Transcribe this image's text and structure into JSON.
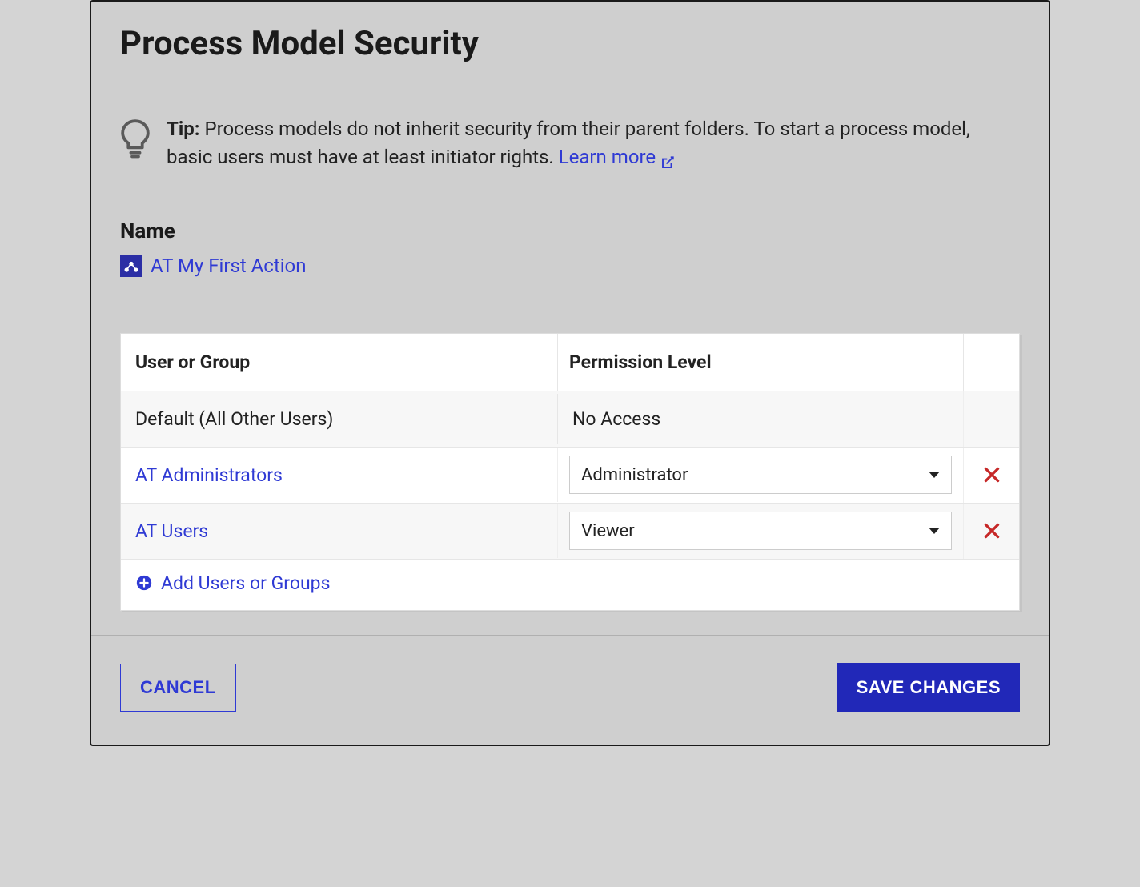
{
  "dialog": {
    "title": "Process Model Security"
  },
  "tip": {
    "label": "Tip:",
    "text": "Process models do not inherit security from their parent folders. To start a process model, basic users must have at least initiator rights.",
    "learn_more": "Learn more"
  },
  "name_section": {
    "label": "Name",
    "model_name": "AT My First Action"
  },
  "table": {
    "col_user": "User or Group",
    "col_perm": "Permission Level",
    "default_row": {
      "user": "Default (All Other Users)",
      "perm": "No Access"
    },
    "rows": [
      {
        "user": "AT Administrators",
        "perm": "Administrator"
      },
      {
        "user": "AT Users",
        "perm": "Viewer"
      }
    ],
    "add_label": "Add Users or Groups"
  },
  "footer": {
    "cancel": "CANCEL",
    "save": "SAVE CHANGES"
  }
}
